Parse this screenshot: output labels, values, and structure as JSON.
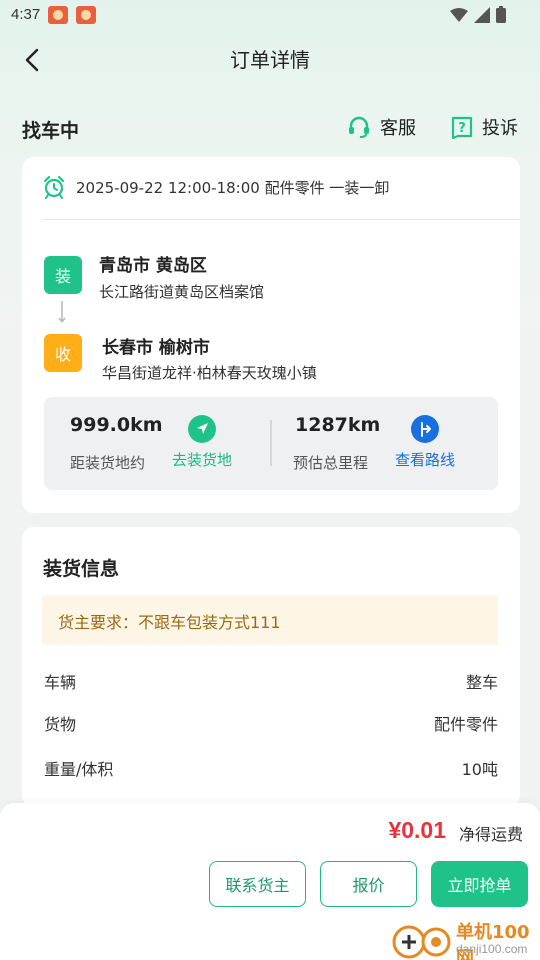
{
  "status_bar": {
    "time": "4:37"
  },
  "header": {
    "title": "订单详情"
  },
  "order": {
    "status": "找车中",
    "actions": [
      {
        "label": "客服",
        "icon": "headset-icon"
      },
      {
        "label": "投诉",
        "icon": "complaint-icon"
      }
    ]
  },
  "route": {
    "time_info": "2025-09-22 12:00-18:00 配件零件 一装一卸",
    "load": {
      "tag": "装",
      "city": "青岛市 黄岛区",
      "address": "长江路街道黄岛区档案馆"
    },
    "unload": {
      "tag": "收",
      "city": "长春市 榆树市",
      "address": "华昌街道龙祥·柏林春天玫瑰小镇"
    },
    "distance_to_load": {
      "value": "999.0km",
      "label": "距装货地约",
      "action": "去装货地"
    },
    "total_distance": {
      "value": "1287km",
      "label": "预估总里程",
      "action": "查看路线"
    }
  },
  "loading_info": {
    "title": "装货信息",
    "notice": "货主要求：不跟车包装方式111",
    "rows": [
      {
        "label": "车辆",
        "value": "整车"
      },
      {
        "label": "货物",
        "value": "配件零件"
      },
      {
        "label": "重量/体积",
        "value": "10吨"
      }
    ]
  },
  "footer": {
    "price": "¥0.01",
    "price_label": "净得运费",
    "buttons": {
      "contact": "联系货主",
      "quote": "报价",
      "grab": "立即抢单"
    }
  },
  "watermark": {
    "name": "单机100网",
    "url": "danji100.com"
  },
  "colors": {
    "accent": "#1fc38a",
    "price": "#e8333c",
    "unload_tag": "#ffae17",
    "link_blue": "#1a6fe0"
  }
}
